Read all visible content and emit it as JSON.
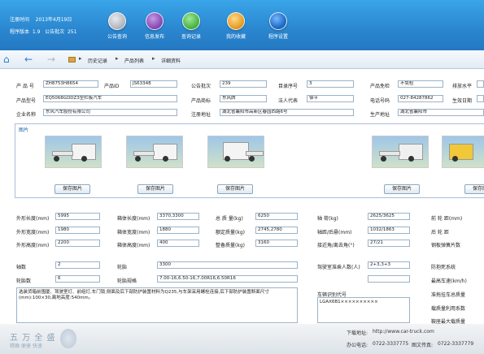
{
  "header": {
    "login_time_label": "注册时间",
    "login_time_value": "2013年4月19日",
    "version_label": "程序版本",
    "version_value": "1.9",
    "announce_label": "公告批次",
    "announce_value": "251",
    "buttons": [
      {
        "label": "公告查询",
        "icon": "gray-disc-icon",
        "color": "#b8bcc2"
      },
      {
        "label": "信息发布",
        "icon": "purple-disc-icon",
        "color": "#8a4fb8"
      },
      {
        "label": "查询记录",
        "icon": "green-disc-icon",
        "color": "#4fb848"
      },
      {
        "label": "我的收藏",
        "icon": "orange-disc-icon",
        "color": "#e8a12a"
      },
      {
        "label": "程序设置",
        "icon": "blue-disc-icon",
        "color": "#1e6fc8"
      }
    ]
  },
  "nav": {
    "crumb1": "历史记录",
    "crumb2": "产品列表",
    "crumb3": "详细资料"
  },
  "info": {
    "row1": {
      "product_no_label": "产 品 号",
      "product_no": "ZH8753H8654",
      "product_id_label": "产品ID",
      "product_id": "JS63348",
      "batch_label": "公告批次",
      "batch": "239",
      "catalog_label": "目录序号",
      "catalog": "3",
      "exempt_label": "产品免检",
      "exempt": "不免检",
      "fuel_label": "排放水平"
    },
    "row2": {
      "model_label": "产品型号",
      "model": "EQ5068GDDZ3型栏板汽车",
      "trademark_label": "产品商标",
      "trademark": "东风牌",
      "legal_label": "法人代表",
      "legal": "徐平",
      "phone_label": "电话号码",
      "phone": "027-84287862",
      "date_label": "生效日期"
    },
    "row3": {
      "company_label": "企业名称",
      "company": "东风汽车股份有限公司",
      "reg_addr_label": "注册地址",
      "reg_addr": "湖北省襄阳市高新区春园西路6号",
      "prod_addr_label": "生产地址",
      "prod_addr": "湖北省襄阳市"
    }
  },
  "photos": {
    "title": "图片",
    "save_label": "保存图片"
  },
  "spec": {
    "len_label": "外形长度(mm)",
    "len": "5995",
    "box_len_label": "箱体长度(mm)",
    "box_len": "3370,3300",
    "gross_label": "总 质 量(kg)",
    "gross": "6250",
    "axle_load_label": "轴 荷(kg)",
    "axle_load": "2625/3625",
    "front_wheel_label": "前 轮 距(mm)",
    "wid_label": "外形宽度(mm)",
    "wid": "1980",
    "box_wid_label": "箱体宽度(mm)",
    "box_wid": "1880",
    "rated_label": "额定质量(kg)",
    "rated": "2745,2780",
    "axle_base_label": "轴距/后悬(mm)",
    "axle_base": "1032/1863",
    "rear_wheel_label": "后 轮 距",
    "hei_label": "外形高度(mm)",
    "hei": "2200",
    "box_hei_label": "箱体高度(mm)",
    "box_hei": "400",
    "curb_label": "整备质量(kg)",
    "curb": "3160",
    "angle_label": "接近角/离去角(°)",
    "angle": "27/21",
    "leaf_label": "钢板弹簧片数",
    "axles_label": "轴数",
    "axles": "2",
    "tire_label": "轮胎",
    "tire": "3300",
    "cab_label": "驾驶室准乘人数(人)",
    "cab": "2+3,3+3",
    "abs_label": "防抱死系统",
    "wheels_label": "轮胎数",
    "wheels": "6",
    "tire_spec_label": "轮胎规格",
    "tire_spec": "7.00-16,6.50-16,7.00R16,6.50R16",
    "trailer_label": "最高车速(km/h)",
    "trailer_val": "",
    "speed_label": "最高车速(km/h)",
    "vin_label": "车辆识别代号",
    "vin": "LGAX6B1××××××××××",
    "trac_label": "准拖挂车总质量",
    "load_label": "载质量利用系数",
    "semi_label": "鞍座最大载质量",
    "remark_label": "其他",
    "remark": "选装货箱前围厦、驾驶室灯、前组灯,车门锁,侧面及后下部防护装置材料为Q235,与车架采用螺栓连接,后下部防护装置断面尺寸(mm):100×30,离地高度:540mm。"
  },
  "footer": {
    "logo_text": "五 万 全 盛",
    "logo_sub": "精确 便捷 快速",
    "site_label": "下载地址:",
    "site": "http://www.car-truck.com",
    "tel_label": "办公电话:",
    "tel": "0722-3337775",
    "fax_label": "图文传真:",
    "fax": "0722-3337779"
  }
}
